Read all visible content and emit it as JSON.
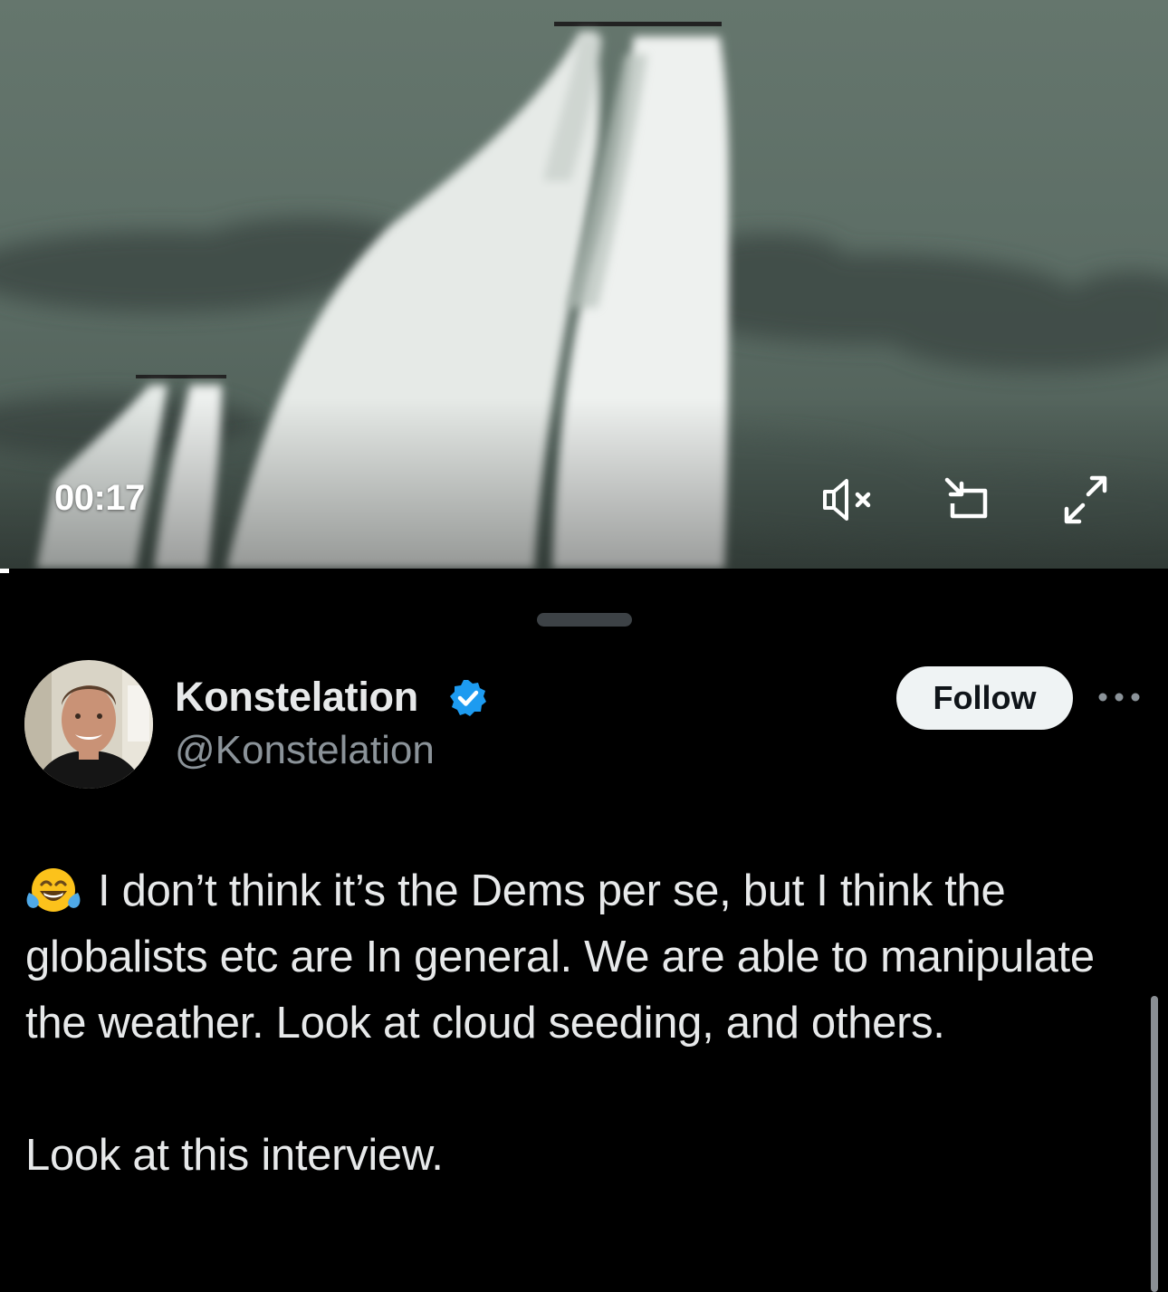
{
  "video": {
    "timestamp": "00:17",
    "progress_fraction": 0.008,
    "icons": {
      "back": "chevron-left-icon",
      "mute": "speaker-muted-icon",
      "pip": "picture-in-picture-icon",
      "fullscreen": "expand-icon"
    }
  },
  "tweet": {
    "author": {
      "display_name": "Konstelation",
      "handle": "@Konstelation",
      "verified": true,
      "verified_color": "#1d9bf0"
    },
    "follow_label": "Follow",
    "emoji": "😂",
    "paragraphs": [
      "I don’t think it’s the Dems per se, but I think the globalists etc are In general.  We are able to manipulate the weather. Look at cloud seeding, and others.",
      "Look at this interview."
    ]
  },
  "colors": {
    "background": "#000000",
    "text": "#e7e9ea",
    "secondary_text": "#8b9399",
    "follow_bg": "#eff3f4",
    "follow_text": "#0f1419"
  }
}
